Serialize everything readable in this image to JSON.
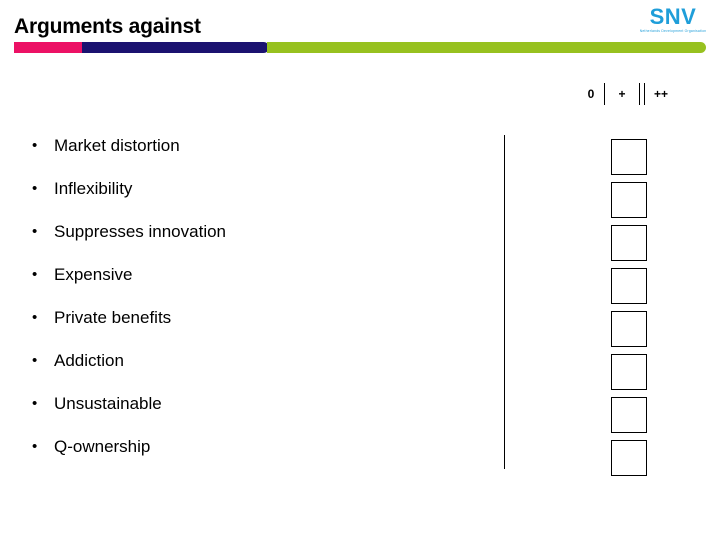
{
  "header": {
    "title": "Arguments against",
    "accent_colors": {
      "pink": "#ec1165",
      "navy": "#1b1270",
      "green": "#97c11f"
    }
  },
  "brand": {
    "wordmark": "SNV",
    "tagline": "Netherlands Development Organisation",
    "color": "#1f9ed9"
  },
  "scale_header": {
    "labels": [
      "0",
      "+",
      "++"
    ]
  },
  "main": {
    "bullets": [
      {
        "marker": "•",
        "label": "Market distortion"
      },
      {
        "marker": "•",
        "label": "Inflexibility"
      },
      {
        "marker": "•",
        "label": "Suppresses innovation"
      },
      {
        "marker": "•",
        "label": "Expensive"
      },
      {
        "marker": "•",
        "label": "Private benefits"
      },
      {
        "marker": "•",
        "label": "Addiction"
      },
      {
        "marker": "•",
        "label": "Unsustainable"
      },
      {
        "marker": "•",
        "label": "Q-ownership"
      }
    ],
    "rating_boxes": [
      {
        "value": ""
      },
      {
        "value": ""
      },
      {
        "value": ""
      },
      {
        "value": ""
      },
      {
        "value": ""
      },
      {
        "value": ""
      },
      {
        "value": ""
      },
      {
        "value": ""
      }
    ]
  }
}
